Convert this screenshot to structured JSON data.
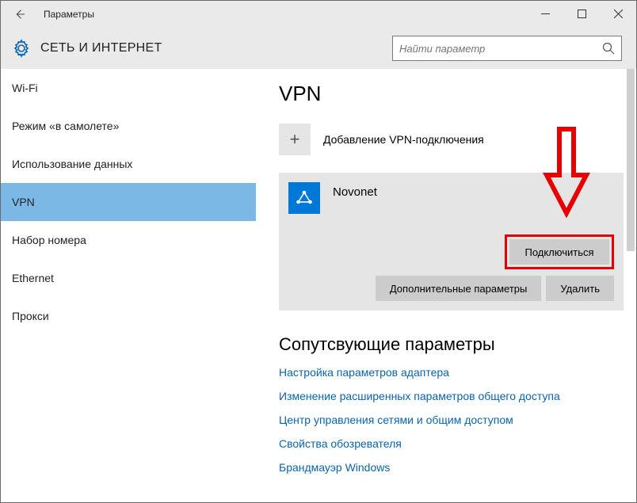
{
  "titlebar": {
    "title": "Параметры"
  },
  "header": {
    "title": "СЕТЬ И ИНТЕРНЕТ",
    "search_placeholder": "Найти параметр"
  },
  "sidebar": {
    "items": [
      {
        "label": "Wi-Fi"
      },
      {
        "label": "Режим «в самолете»"
      },
      {
        "label": "Использование данных"
      },
      {
        "label": "VPN",
        "selected": true
      },
      {
        "label": "Набор номера"
      },
      {
        "label": "Ethernet"
      },
      {
        "label": "Прокси"
      }
    ]
  },
  "main": {
    "title": "VPN",
    "add_label": "Добавление VPN-подключения",
    "connection": {
      "name": "Novonet",
      "connect_label": "Подключиться",
      "advanced_label": "Дополнительные параметры",
      "delete_label": "Удалить"
    },
    "related": {
      "title": "Сопутсвующие параметры",
      "links": [
        "Настройка параметров адаптера",
        "Изменение расширенных параметров общего доступа",
        "Центр управления сетями и общим доступом",
        "Свойства обозревателя",
        "Брандмауэр Windows"
      ]
    }
  }
}
